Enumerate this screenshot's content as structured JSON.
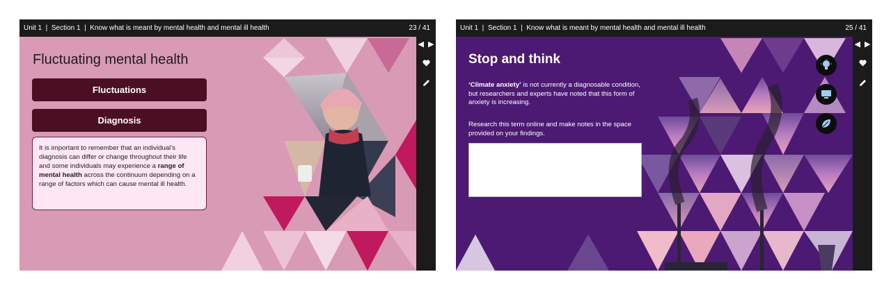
{
  "slides": [
    {
      "breadcrumb": [
        "Unit 1",
        "Section 1",
        "Know what is meant by mental health and mental ill health"
      ],
      "counter": "23 / 41",
      "title": "Fluctuating mental health",
      "buttons": [
        "Fluctuations",
        "Diagnosis"
      ],
      "info": {
        "part1": "It is important to remember that an individual’s diagnosis can differ or change throughout their life and some individuals may experience a ",
        "bold": "range of mental health",
        "part2": " across the continuum depending on a range of factors which can cause mental ill health."
      },
      "side_icons": [
        "prev-arrow-icon",
        "next-arrow-icon",
        "heart-icon",
        "pencil-icon"
      ],
      "colors": {
        "background": "#d99ab5",
        "button": "#4b0f23",
        "box": "#fde7f5"
      }
    },
    {
      "breadcrumb": [
        "Unit 1",
        "Section 1",
        "Know what is meant by mental health and mental ill health"
      ],
      "counter": "25 / 41",
      "title": "Stop and think",
      "para1": {
        "bold": "‘Climate anxiety’",
        "rest": " is not currently a diagnosable condition, but researchers and experts have noted that this form of anxiety is increasing."
      },
      "para2": "Research this term online and make notes in the space provided on your findings.",
      "notes_value": "",
      "round_icons": [
        "lightbulb-icon",
        "computer-icon",
        "leaf-icon"
      ],
      "side_icons": [
        "prev-arrow-icon",
        "next-arrow-icon",
        "heart-icon",
        "pencil-icon"
      ],
      "colors": {
        "background": "#4c1a72"
      }
    }
  ]
}
